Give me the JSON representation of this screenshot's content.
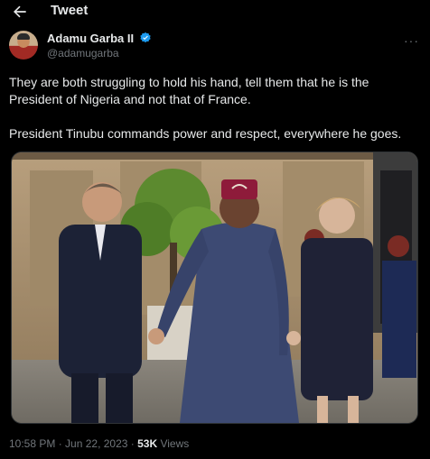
{
  "header": {
    "title": "Tweet"
  },
  "author": {
    "display_name": "Adamu Garba II",
    "handle": "@adamugarba"
  },
  "tweet": {
    "paragraph_1": "They are both struggling to hold his hand, tell them that he is the President of Nigeria and not that of France.",
    "paragraph_2": "President Tinubu commands power and respect, everywhere he goes."
  },
  "meta": {
    "time": "10:58 PM",
    "sep1": " · ",
    "date": "Jun 22, 2023",
    "sep2": " · ",
    "views_count": "53K",
    "views_label": " Views"
  },
  "colors": {
    "background": "#000000",
    "text": "#e7e9ea",
    "secondary": "#71767b",
    "verified": "#1d9bf0"
  }
}
